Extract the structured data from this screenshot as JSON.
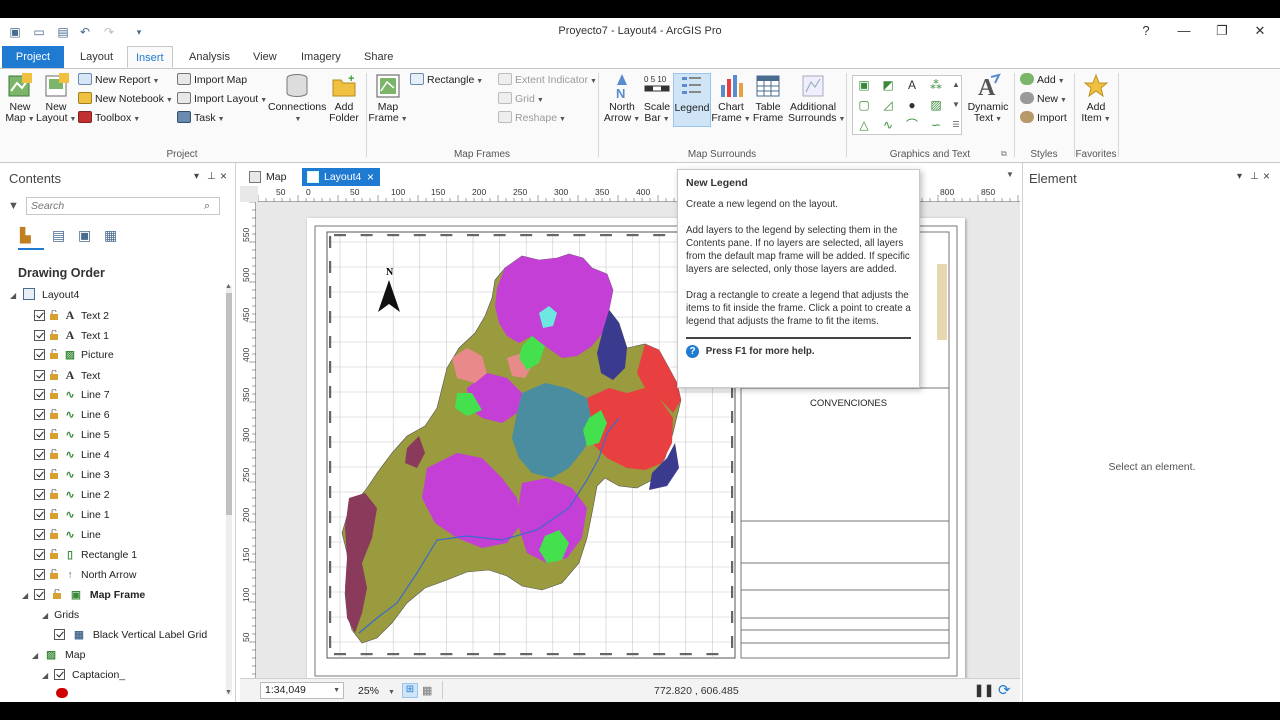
{
  "window": {
    "title": "Proyecto7 - Layout4 - ArcGIS Pro",
    "help": "?",
    "minimize": "—",
    "restore": "❐",
    "close": "✕"
  },
  "ribbon_tabs": [
    "Project",
    "Layout",
    "Insert",
    "Analysis",
    "View",
    "Imagery",
    "Share"
  ],
  "ribbon": {
    "project": {
      "label": "Project",
      "new_map": "New Map",
      "new_layout": "New Layout",
      "new_report": "New Report",
      "new_notebook": "New Notebook",
      "toolbox": "Toolbox",
      "import_map": "Import Map",
      "import_layout": "Import Layout",
      "task": "Task",
      "connections": "Connections",
      "add_folder": "Add Folder"
    },
    "map_frames": {
      "label": "Map Frames",
      "map_frame": "Map Frame",
      "rectangle": "Rectangle",
      "extent_indicator": "Extent Indicator",
      "grid": "Grid",
      "reshape": "Reshape"
    },
    "map_surrounds": {
      "label": "Map Surrounds",
      "north_arrow": "North Arrow",
      "scale_bar": "Scale Bar",
      "legend": "Legend",
      "chart_frame": "Chart Frame",
      "table_frame": "Table Frame",
      "additional_surrounds": "Additional Surrounds"
    },
    "graphics_text": {
      "label": "Graphics and Text",
      "dynamic_text": "Dynamic Text"
    },
    "styles": {
      "label": "Styles",
      "add": "Add",
      "new": "New",
      "import": "Import"
    },
    "favorites": {
      "label": "Favorites",
      "add_item": "Add Item"
    }
  },
  "contents": {
    "title": "Contents",
    "search_placeholder": "Search",
    "drawing_order": "Drawing Order",
    "layout_name": "Layout4",
    "items": [
      {
        "label": "Text 2",
        "icon": "A"
      },
      {
        "label": "Text 1",
        "icon": "A"
      },
      {
        "label": "Picture",
        "icon": "pic"
      },
      {
        "label": "Text",
        "icon": "A"
      },
      {
        "label": "Line 7",
        "icon": "line"
      },
      {
        "label": "Line 6",
        "icon": "line"
      },
      {
        "label": "Line 5",
        "icon": "line"
      },
      {
        "label": "Line 4",
        "icon": "line"
      },
      {
        "label": "Line 3",
        "icon": "line"
      },
      {
        "label": "Line 2",
        "icon": "line"
      },
      {
        "label": "Line 1",
        "icon": "line"
      },
      {
        "label": "Line",
        "icon": "line"
      },
      {
        "label": "Rectangle 1",
        "icon": "rect"
      },
      {
        "label": "North Arrow",
        "icon": "arrow"
      }
    ],
    "map_frame": "Map Frame",
    "grids": "Grids",
    "grid_item": "Black Vertical Label Grid",
    "map": "Map",
    "layer": "Captacion_"
  },
  "doc_tabs": {
    "map": "Map",
    "layout": "Layout4"
  },
  "ruler_h": [
    "50",
    "0",
    "50",
    "100",
    "150",
    "200",
    "250",
    "300",
    "350",
    "400",
    "450",
    "800",
    "850"
  ],
  "ruler_v": [
    "550",
    "500",
    "450",
    "400",
    "350",
    "300",
    "250",
    "200",
    "150",
    "100",
    "50"
  ],
  "layout": {
    "north_label": "N",
    "convenciones": "CONVENCIONES"
  },
  "statusbar": {
    "scale": "1:34,049",
    "zoom": "25%",
    "coords": "772.820 , 606.485"
  },
  "element_pane": {
    "title": "Element",
    "empty_message": "Select an element."
  },
  "tooltip": {
    "title": "New Legend",
    "p1": "Create a new legend on the layout.",
    "p2": "Add layers to the legend by selecting them in the Contents pane. If no layers are selected, all layers from the default map frame will be added. If specific layers are selected, only those layers are added.",
    "p3": "Drag a rectangle to create a legend that adjusts the items to fit inside the frame.   Click a point to create a legend that adjusts the frame to fit the items.",
    "help": "Press F1 for more help."
  },
  "colors": {
    "accent": "#1f7ad1",
    "olive": "#9a9a3e",
    "magenta": "#c43fd6",
    "teal": "#4a8da0",
    "red": "#e84040",
    "navy": "#3a3a8e",
    "green": "#44e04e",
    "pink": "#e88a8a",
    "maroon": "#8a3a5a"
  }
}
